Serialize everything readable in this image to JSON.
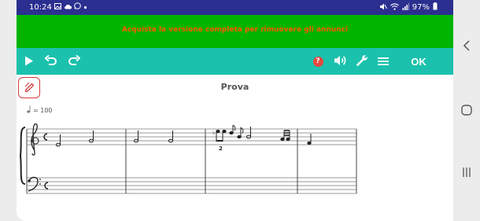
{
  "status_bar": {
    "time": "10:24",
    "left_icons": [
      "image-icon",
      "cloud-icon",
      "whatsapp-icon",
      "dot-icon"
    ],
    "right_icons": [
      "mute-icon",
      "wifi-icon",
      "signal-icon"
    ],
    "battery": "97%"
  },
  "banner": {
    "text": "Acquista la versione completa per rimuovere gli annunci",
    "background": "#00b400",
    "text_color": "#ff5a00"
  },
  "toolbar": {
    "background": "#1bc1ad",
    "ok_label": "OK",
    "help_label": "?",
    "icons": [
      "play-icon",
      "undo-icon",
      "redo-icon",
      "help-icon",
      "volume-icon",
      "wrench-icon",
      "menu-icon"
    ]
  },
  "score": {
    "title": "Prova",
    "tempo": "= 100",
    "triplet_number": "2"
  },
  "colors": {
    "status_bar": "#2b2f8f",
    "edit_border": "#d23b3b"
  }
}
